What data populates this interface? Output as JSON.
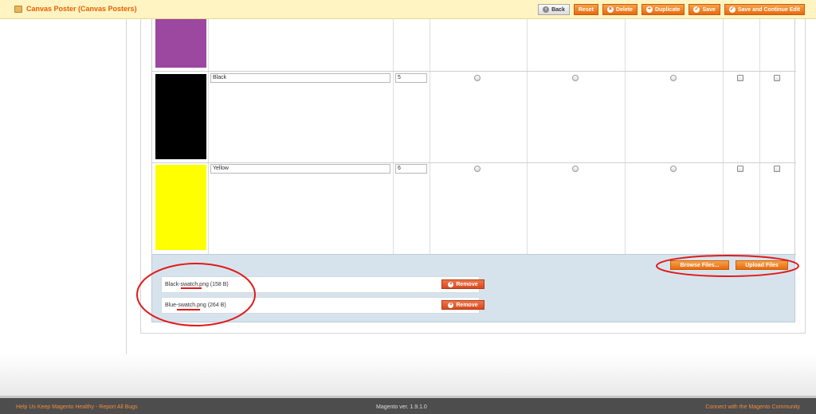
{
  "header": {
    "title": "Canvas Poster (Canvas Posters)",
    "buttons": {
      "back": "Back",
      "reset": "Reset",
      "delete": "Delete",
      "duplicate": "Duplicate",
      "save": "Save",
      "save_continue": "Save and Continue Edit"
    }
  },
  "swatches": [
    {
      "color": "#9c47a0",
      "label": "",
      "order": ""
    },
    {
      "color": "#000000",
      "label": "Black",
      "order": "5"
    },
    {
      "color": "#ffff00",
      "label": "Yellow",
      "order": "6"
    }
  ],
  "uploader": {
    "browse_label": "Browse Files...",
    "upload_label": "Upload Files",
    "files": [
      {
        "name": "Black-swatch.png (158 B)",
        "remove_label": "Remove"
      },
      {
        "name": "Blue-swatch.png (264 B)",
        "remove_label": "Remove"
      }
    ]
  },
  "footer": {
    "left_text": "Help Us Keep Magento Healthy - Report All Bugs",
    "center_text": "Magento ver. 1.9.1.0",
    "right_text": "Connect with the Magento Community"
  },
  "colors": {
    "accent": "#eb5e00",
    "annotation": "#e01b1b",
    "upload_bg": "#d7e3ec"
  }
}
